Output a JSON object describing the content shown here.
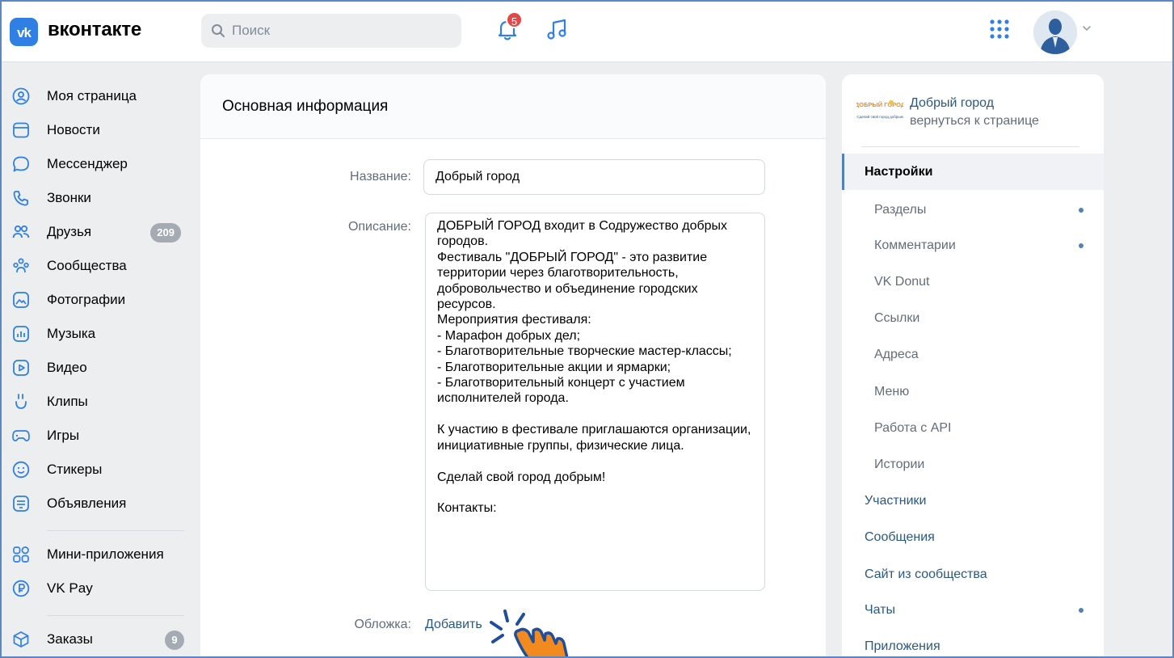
{
  "header": {
    "logo_letters": "vk",
    "logo_text": "вконтакте",
    "search_placeholder": "Поиск",
    "notifications_count": "5"
  },
  "sidebar": {
    "items": [
      {
        "label": "Моя страница",
        "icon": "user-circle-icon"
      },
      {
        "label": "Новости",
        "icon": "news-icon"
      },
      {
        "label": "Мессенджер",
        "icon": "message-icon"
      },
      {
        "label": "Звонки",
        "icon": "phone-icon"
      },
      {
        "label": "Друзья",
        "icon": "friends-icon",
        "count": "209"
      },
      {
        "label": "Сообщества",
        "icon": "communities-icon"
      },
      {
        "label": "Фотографии",
        "icon": "photo-icon"
      },
      {
        "label": "Музыка",
        "icon": "music-icon"
      },
      {
        "label": "Видео",
        "icon": "video-icon"
      },
      {
        "label": "Клипы",
        "icon": "clips-icon"
      },
      {
        "label": "Игры",
        "icon": "gamepad-icon"
      },
      {
        "label": "Стикеры",
        "icon": "sticker-icon"
      },
      {
        "label": "Объявления",
        "icon": "ads-icon"
      }
    ],
    "items2": [
      {
        "label": "Мини-приложения",
        "icon": "mini-apps-icon"
      },
      {
        "label": "VK Pay",
        "icon": "vkpay-icon"
      }
    ],
    "items3": [
      {
        "label": "Заказы",
        "icon": "box-icon",
        "count": "9"
      }
    ]
  },
  "main": {
    "title": "Основная информация",
    "name_label": "Название:",
    "name_value": "Добрый город",
    "desc_label": "Описание:",
    "desc_value": "ДОБРЫЙ ГОРОД входит в Содружество добрых городов.\nФестиваль \"ДОБРЫЙ ГОРОД\" - это развитие территории через благотворительность, добровольчество и объединение городских ресурсов.\nМероприятия фестиваля:\n- Марафон добрых дел;\n- Благотворительные творческие мастер-классы;\n- Благотворительные акции и ярмарки;\n- Благотворительный концерт с участием исполнителей города.\n\nК участию в фестивале приглашаются организации, инициативные группы, физические лица.\n\nСделай свой город добрым!\n\nКонтакты:",
    "cover_label": "Обложка:",
    "cover_add": "Добавить"
  },
  "right": {
    "group_name": "Добрый город",
    "group_back": "вернуться к странице",
    "logo_text": "ДОБРЫЙ ГОРОД",
    "logo_sub": "Сделай свой город добрым",
    "menu": [
      {
        "label": "Настройки",
        "active": true,
        "sub": false,
        "dot": false
      },
      {
        "label": "Разделы",
        "sub": true,
        "dot": true
      },
      {
        "label": "Комментарии",
        "sub": true,
        "dot": true
      },
      {
        "label": "VK Donut",
        "sub": true,
        "dot": false
      },
      {
        "label": "Ссылки",
        "sub": true,
        "dot": false
      },
      {
        "label": "Адреса",
        "sub": true,
        "dot": false
      },
      {
        "label": "Меню",
        "sub": true,
        "dot": false
      },
      {
        "label": "Работа с API",
        "sub": true,
        "dot": false
      },
      {
        "label": "Истории",
        "sub": true,
        "dot": false
      },
      {
        "label": "Участники",
        "sub": false,
        "dot": false
      },
      {
        "label": "Сообщения",
        "sub": false,
        "dot": false
      },
      {
        "label": "Сайт из сообщества",
        "sub": false,
        "dot": false
      },
      {
        "label": "Чаты",
        "sub": false,
        "dot": true
      },
      {
        "label": "Приложения",
        "sub": false,
        "dot": false
      }
    ]
  },
  "colors": {
    "accent": "#2a5885",
    "link": "#2a5885",
    "brand": "#2f7fe5",
    "highlight": "#f28a1f"
  }
}
